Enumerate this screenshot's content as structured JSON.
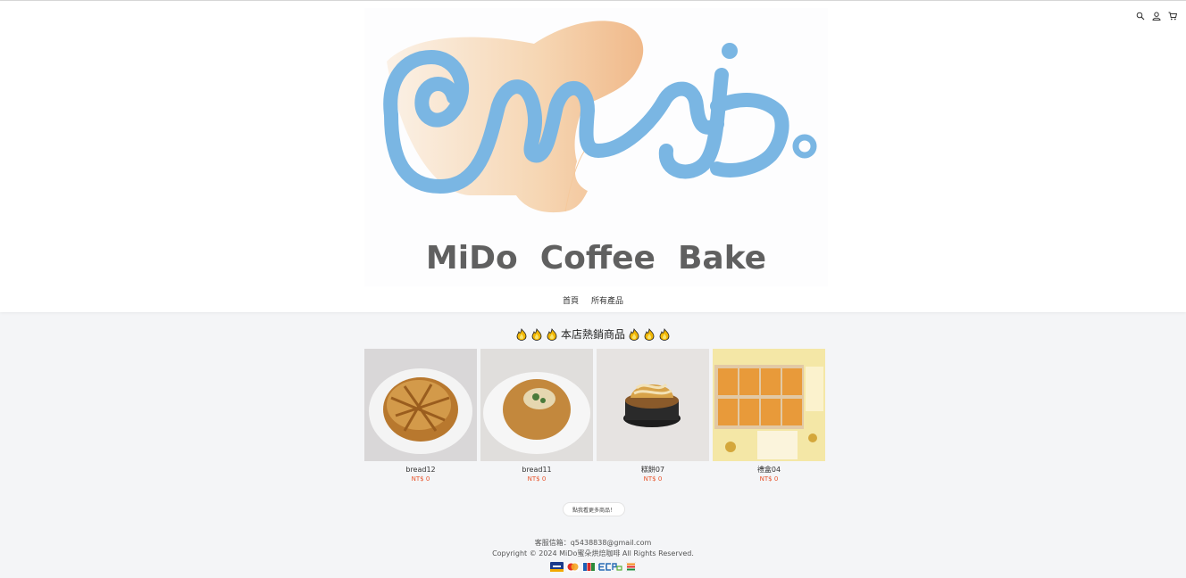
{
  "header": {
    "icons": [
      "search-icon",
      "user-icon",
      "cart-icon"
    ],
    "logo_text": "MiDo  Coffee  Bake",
    "logo_colors": {
      "blue": "#7ab6e3",
      "peach": "#f3c79c",
      "text": "#606060"
    }
  },
  "nav": {
    "items": [
      {
        "label": "首頁"
      },
      {
        "label": "所有產品"
      }
    ]
  },
  "hot": {
    "title": "本店熱銷商品",
    "emoji_count_each_side": 3,
    "products": [
      {
        "name": "bread12",
        "price": "NT$ 0"
      },
      {
        "name": "bread11",
        "price": "NT$ 0"
      },
      {
        "name": "糕餅07",
        "price": "NT$ 0"
      },
      {
        "name": "禮盒04",
        "price": "NT$ 0"
      }
    ]
  },
  "more_button": "點我看更多商品！",
  "footer": {
    "contact": "客服信箱：q5438838@gmail.com",
    "copyright": "Copyright © 2024 MiDo蜜朵烘焙咖啡 All Rights Reserved.",
    "payment_icons": [
      "visa-icon",
      "mastercard-icon",
      "jcb-icon",
      "ecpay-icon",
      "seven-eleven-icon"
    ]
  },
  "colors": {
    "accent_price": "#e8532a",
    "page_bg": "#f4f5f7"
  }
}
